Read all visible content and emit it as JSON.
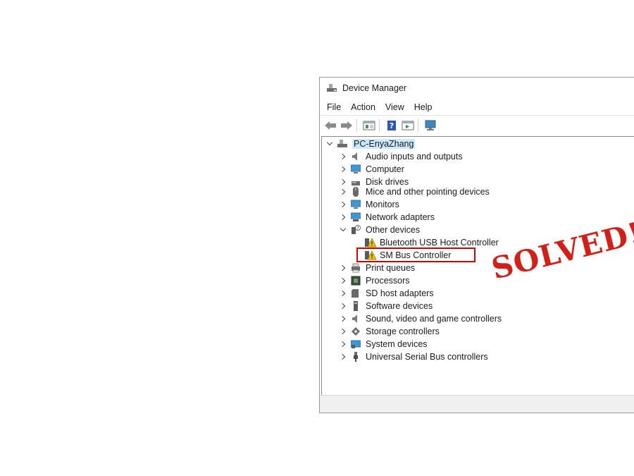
{
  "window": {
    "title": "Device Manager"
  },
  "menu": [
    "File",
    "Action",
    "View",
    "Help"
  ],
  "toolbar": {
    "icons": [
      "back-arrow-icon",
      "forward-arrow-icon",
      "properties-icon",
      "help-icon",
      "update-driver-icon",
      "monitor-icon"
    ]
  },
  "tree": {
    "root": "PC-EnyaZhang",
    "categories": [
      "Audio inputs and outputs",
      "Computer",
      "Disk drives",
      "Mice and other pointing devices",
      "Monitors",
      "Network adapters",
      "Other devices"
    ],
    "other_devices": [
      "Bluetooth USB Host Controller",
      "SM Bus Controller"
    ],
    "categories_after": [
      "Print queues",
      "Processors",
      "SD host adapters",
      "Software devices",
      "Sound, video and game controllers",
      "Storage controllers",
      "System devices",
      "Universal Serial Bus controllers"
    ]
  },
  "stamp": "SOLVED!",
  "colors": {
    "highlight": "#d00000",
    "stamp": "#d0201a",
    "selection": "#cce8ff",
    "warning": "#f2c200"
  }
}
